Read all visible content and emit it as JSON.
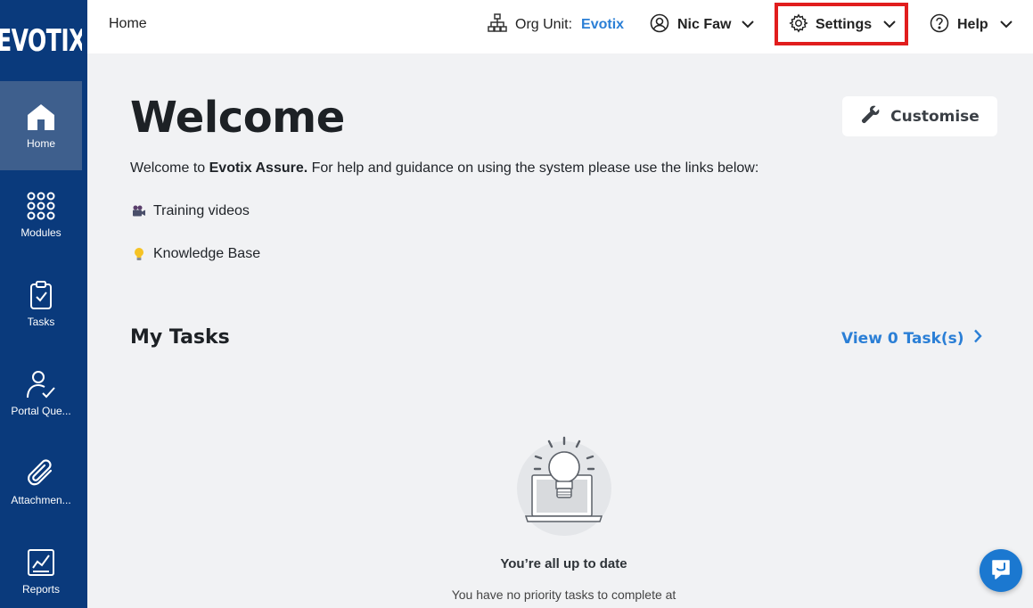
{
  "brand": {
    "logo_text": "EVOTIX",
    "sidebar_color": "#0a3a7c",
    "accent": "#2b7fd6",
    "highlight": "#e11d1d"
  },
  "sidebar": {
    "items": [
      {
        "label": "Home",
        "icon": "home-icon",
        "active": true
      },
      {
        "label": "Modules",
        "icon": "grid-dots-icon",
        "active": false
      },
      {
        "label": "Tasks",
        "icon": "clipboard-check-icon",
        "active": false
      },
      {
        "label": "Portal Que...",
        "icon": "user-check-icon",
        "active": false
      },
      {
        "label": "Attachmen...",
        "icon": "paperclip-icon",
        "active": false
      },
      {
        "label": "Reports",
        "icon": "chart-report-icon",
        "active": false
      }
    ]
  },
  "topbar": {
    "breadcrumb": "Home",
    "org_unit_label": "Org Unit:",
    "org_unit_value": "Evotix",
    "user_name": "Nic Faw",
    "settings_label": "Settings",
    "help_label": "Help"
  },
  "main": {
    "title": "Welcome",
    "customise_label": "Customise",
    "intro_prefix": "Welcome to ",
    "intro_product": "Evotix Assure.",
    "intro_suffix": " For help and guidance on using the system please use the links below:",
    "links": [
      {
        "label": "Training videos",
        "icon": "movie-camera-icon"
      },
      {
        "label": "Knowledge Base",
        "icon": "lightbulb-icon"
      }
    ],
    "tasks_title": "My Tasks",
    "view_tasks_label": "View 0 Task(s)",
    "empty_title": "You’re all up to date",
    "empty_text": "You have no priority tasks to complete at"
  }
}
